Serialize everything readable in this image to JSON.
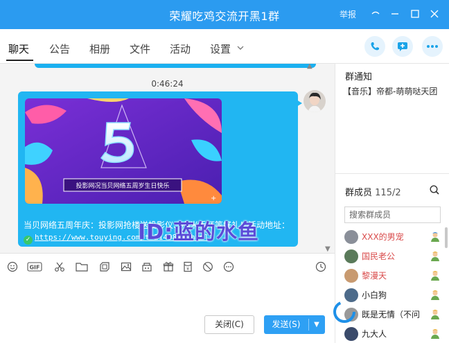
{
  "window": {
    "title": "荣耀吃鸡交流开黑1群",
    "report": "举报",
    "controls": [
      "minimize-icon",
      "restore-icon",
      "maximize-icon",
      "close-icon"
    ]
  },
  "tabs": [
    "聊天",
    "公告",
    "相册",
    "文件",
    "活动",
    "设置"
  ],
  "active_tab": "聊天",
  "call_buttons": [
    "phone-icon",
    "message-add-icon",
    "more-icon"
  ],
  "chat": {
    "timestamp": "0:46:24",
    "banner": {
      "big_text": "5",
      "caption": "投影网况当贝网络五周岁生日快乐"
    },
    "message_text": "当贝网络五周年庆：投影网抢楼送投影仪、小米手环等好礼！活动地址：",
    "link": "https://www.touying.com/t-21408-1.html",
    "watermark": "ID:蓝的水鱼"
  },
  "toolbar": [
    "emoji-icon",
    "gif-icon",
    "scissors-icon",
    "folder-icon",
    "screenshot-icon",
    "image-icon",
    "gift-box-icon",
    "gift-icon",
    "red-packet-icon",
    "forbid-icon",
    "more-icon",
    "clock-icon"
  ],
  "buttons": {
    "close": "关闭(C)",
    "send": "发送(S)"
  },
  "sidebar": {
    "notice_title": "群通知",
    "notice_text": "【音乐】帝都-萌萌哒天团",
    "members_title": "群成员",
    "members_count": "115/2",
    "search_placeholder": "搜索群成员",
    "members": [
      {
        "name": "XXX的男宠",
        "color": "#d94a4a",
        "role": "admin",
        "av": "#8a8f99"
      },
      {
        "name": "国民老公",
        "color": "#d94a4a",
        "role": "member",
        "av": "#5a7a5a"
      },
      {
        "name": "黎漫天",
        "color": "#d94a4a",
        "role": "member",
        "av": "#c89a70"
      },
      {
        "name": "小白狗",
        "color": "#222222",
        "role": "member",
        "av": "#4d6b8a"
      },
      {
        "name": "既是无情（不问",
        "color": "#222222",
        "role": "member",
        "av": "#999999"
      },
      {
        "name": "九大人",
        "color": "#222222",
        "role": "member",
        "av": "#3a4a6a"
      }
    ]
  }
}
